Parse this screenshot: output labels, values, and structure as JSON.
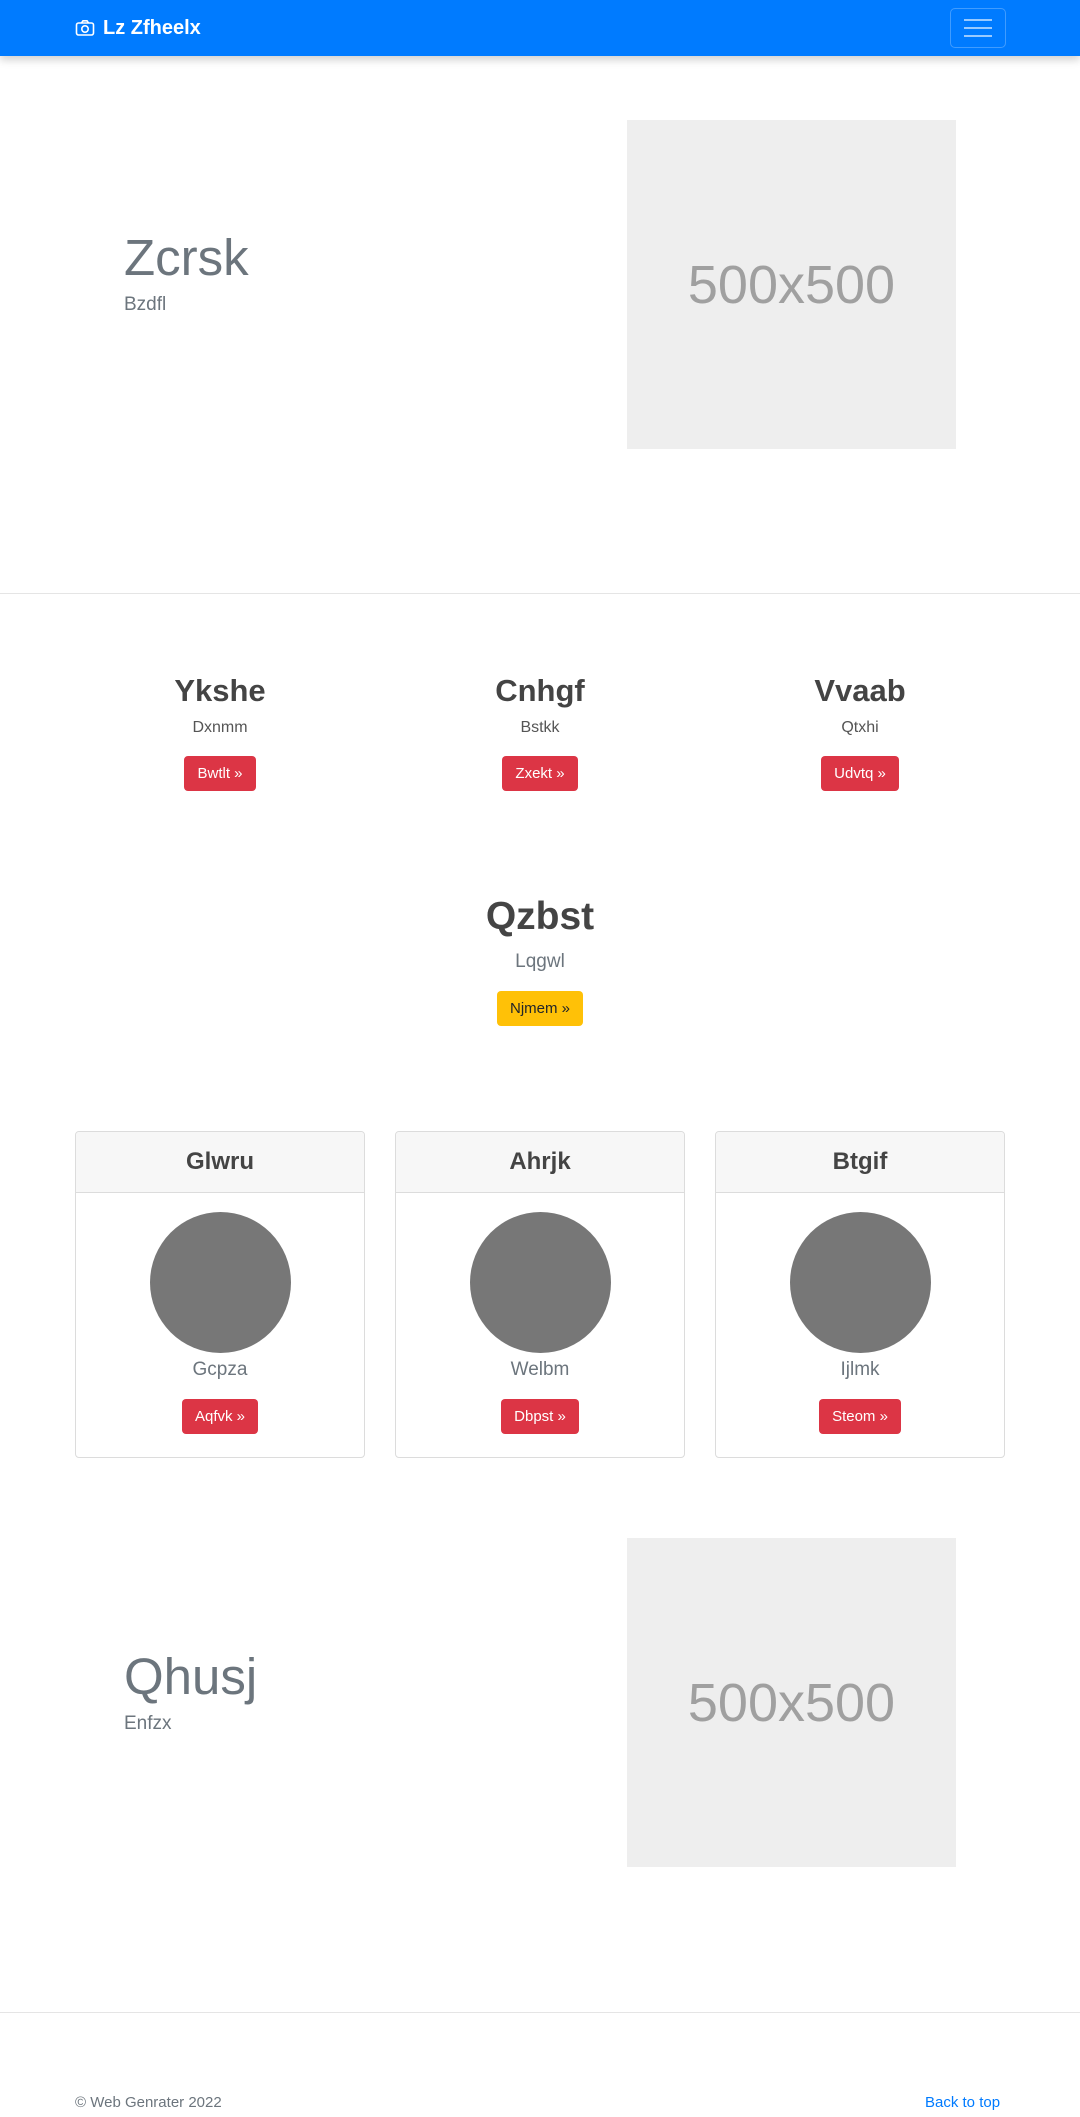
{
  "navbar": {
    "brand": "Lz Zfheelx",
    "brand_icon": "camera-icon",
    "toggler_icon": "hamburger-icon"
  },
  "hero1": {
    "title": "Zcrsk",
    "subtitle": "Bzdfl",
    "image_label": "500x500"
  },
  "columns": [
    {
      "title": "Ykshe",
      "text": "Dxnmm",
      "button": "Bwtlt »"
    },
    {
      "title": "Cnhgf",
      "text": "Bstkk",
      "button": "Zxekt »"
    },
    {
      "title": "Vvaab",
      "text": "Qtxhi",
      "button": "Udvtq »"
    }
  ],
  "feature": {
    "title": "Qzbst",
    "text": "Lqgwl",
    "button": "Njmem »"
  },
  "cards": [
    {
      "header": "Glwru",
      "text": "Gcpza",
      "button": "Aqfvk »"
    },
    {
      "header": "Ahrjk",
      "text": "Welbm",
      "button": "Dbpst »"
    },
    {
      "header": "Btgif",
      "text": "Ijlmk",
      "button": "Steom »"
    }
  ],
  "hero2": {
    "title": "Qhusj",
    "subtitle": "Enfzx",
    "image_label": "500x500"
  },
  "footer": {
    "copyright": "© Web Genrater 2022",
    "back_to_top": "Back to top"
  },
  "colors": {
    "primary": "#007bff",
    "danger": "#dc3545",
    "warning": "#ffc107",
    "placeholder": "#eeeeee",
    "avatar": "#777777"
  }
}
